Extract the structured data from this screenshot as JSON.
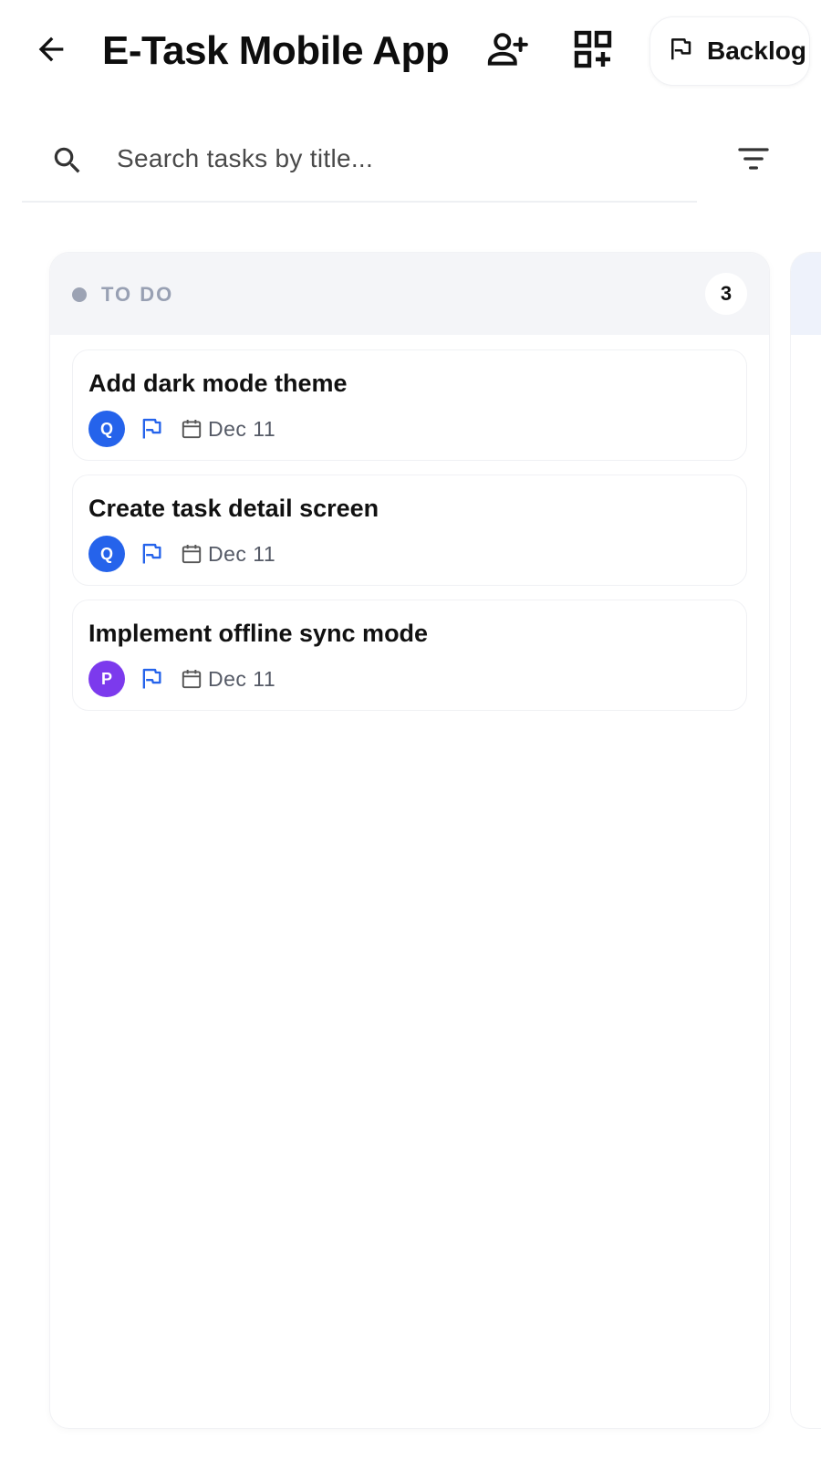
{
  "header": {
    "title": "E-Task Mobile App",
    "back_icon": "arrow-left-icon",
    "add_member_icon": "person-add-icon",
    "add_column_icon": "grid-add-icon",
    "backlog_label": "Backlog",
    "backlog_icon": "flag-icon"
  },
  "search": {
    "placeholder": "Search tasks by title...",
    "value": "",
    "search_icon": "search-icon",
    "filter_icon": "filter-icon"
  },
  "columns": [
    {
      "title": "TO DO",
      "count": "3",
      "status_color": "#9ca3b4",
      "tasks": [
        {
          "title": "Add dark mode theme",
          "assignee_initial": "Q",
          "assignee_color": "#2563eb",
          "priority_icon": "flag-icon",
          "priority_color": "#2563eb",
          "due": "Dec 11"
        },
        {
          "title": "Create task detail screen",
          "assignee_initial": "Q",
          "assignee_color": "#2563eb",
          "priority_icon": "flag-icon",
          "priority_color": "#2563eb",
          "due": "Dec 11"
        },
        {
          "title": "Implement offline sync mode",
          "assignee_initial": "P",
          "assignee_color": "#7c3aed",
          "priority_icon": "flag-icon",
          "priority_color": "#2563eb",
          "due": "Dec 11"
        }
      ]
    }
  ],
  "colors": {
    "accent": "#2563eb",
    "column_header_bg": "#f4f5f8",
    "muted_text": "#98a0b3"
  }
}
